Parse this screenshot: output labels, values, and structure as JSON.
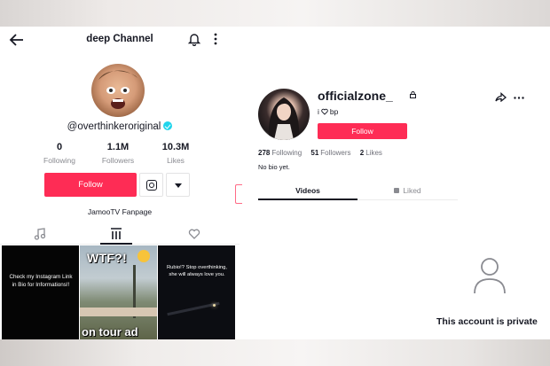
{
  "left_profile": {
    "header_title": "deep Channel",
    "username": "@overthinkeroriginal",
    "stats": [
      {
        "value": "0",
        "label": "Following"
      },
      {
        "value": "1.1M",
        "label": "Followers"
      },
      {
        "value": "10.3M",
        "label": "Likes"
      }
    ],
    "follow_label": "Follow",
    "bio": "JamooTV Fanpage",
    "videos": [
      {
        "caption": "Check my Instagram Link in Bio for Informations!!"
      },
      {
        "overlay_top": "WTF?!",
        "overlay_bottom": "on tour ad"
      },
      {
        "caption": "Rubio!? Stop overthinking, she will always love you."
      }
    ]
  },
  "right_profile": {
    "username": "officialzone_",
    "subtitle_pre": "i",
    "subtitle_post": "bp",
    "follow_label": "Follow",
    "following_count": "278",
    "following_label": "Following",
    "followers_count": "51",
    "followers_label": "Followers",
    "likes_count": "2",
    "likes_label": "Likes",
    "bio": "No bio yet.",
    "tab_videos": "Videos",
    "tab_liked": "Liked",
    "private_message": "This account is private"
  },
  "colors": {
    "accent": "#fe2c55",
    "verified": "#20d5ec",
    "text": "#161823",
    "muted": "#8a8b91"
  }
}
